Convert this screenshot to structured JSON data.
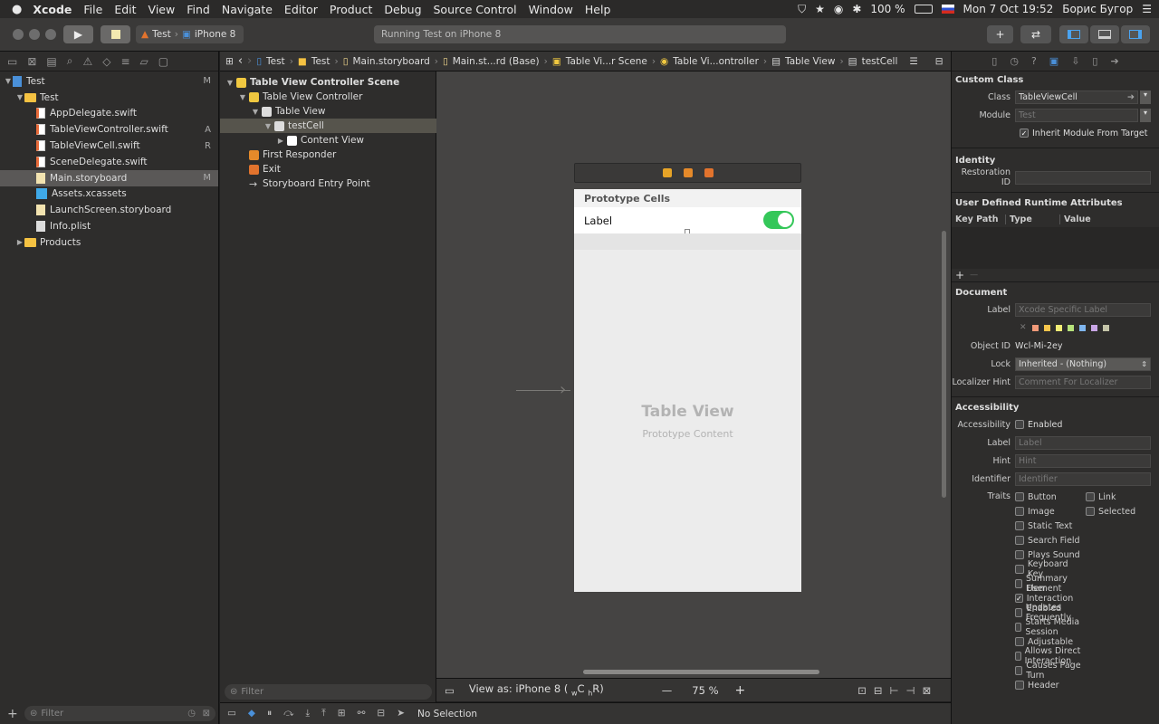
{
  "menubar": {
    "apple": "",
    "app": "Xcode",
    "items": [
      "File",
      "Edit",
      "View",
      "Find",
      "Navigate",
      "Editor",
      "Product",
      "Debug",
      "Source Control",
      "Window",
      "Help"
    ],
    "battery": "100 %",
    "datetime": "Mon 7 Oct  19:52",
    "user": "Борис Бугор"
  },
  "toolbar": {
    "scheme_target": "Test",
    "scheme_device": "iPhone 8",
    "activity": "Running Test on iPhone 8",
    "add": "+",
    "swap": "⇄"
  },
  "navigator": {
    "tree": [
      {
        "label": "Test",
        "badge": "M",
        "indent": 0,
        "type": "project",
        "expanded": true
      },
      {
        "label": "Test",
        "badge": "",
        "indent": 1,
        "type": "folder",
        "expanded": true
      },
      {
        "label": "AppDelegate.swift",
        "badge": "",
        "indent": 2,
        "type": "swift"
      },
      {
        "label": "TableViewController.swift",
        "badge": "A",
        "indent": 2,
        "type": "swift"
      },
      {
        "label": "TableViewCell.swift",
        "badge": "R",
        "indent": 2,
        "type": "swift"
      },
      {
        "label": "SceneDelegate.swift",
        "badge": "",
        "indent": 2,
        "type": "swift"
      },
      {
        "label": "Main.storyboard",
        "badge": "M",
        "indent": 2,
        "type": "storyboard",
        "selected": true
      },
      {
        "label": "Assets.xcassets",
        "badge": "",
        "indent": 2,
        "type": "assets"
      },
      {
        "label": "LaunchScreen.storyboard",
        "badge": "",
        "indent": 2,
        "type": "storyboard"
      },
      {
        "label": "Info.plist",
        "badge": "",
        "indent": 2,
        "type": "plist"
      },
      {
        "label": "Products",
        "badge": "",
        "indent": 1,
        "type": "folder",
        "expanded": false
      }
    ],
    "filter_placeholder": "Filter"
  },
  "jumpbar": {
    "crumbs": [
      "Test",
      "Test",
      "Main.storyboard",
      "Main.st...rd (Base)",
      "Table Vi...r Scene",
      "Table Vi...ontroller",
      "Table View",
      "testCell"
    ]
  },
  "outline": {
    "rows": [
      {
        "label": "Table View Controller Scene",
        "indent": 0,
        "bold": true,
        "tri": "▼"
      },
      {
        "label": "Table View Controller",
        "indent": 1,
        "tri": "▼"
      },
      {
        "label": "Table View",
        "indent": 2,
        "tri": "▼"
      },
      {
        "label": "testCell",
        "indent": 3,
        "tri": "▼",
        "selected": true
      },
      {
        "label": "Content View",
        "indent": 4,
        "tri": "▶"
      },
      {
        "label": "First Responder",
        "indent": 1,
        "tri": ""
      },
      {
        "label": "Exit",
        "indent": 1,
        "tri": ""
      },
      {
        "label": "Storyboard Entry Point",
        "indent": 1,
        "tri": ""
      }
    ],
    "filter_placeholder": "Filter"
  },
  "canvas": {
    "proto_header": "Prototype Cells",
    "cell_label": "Label",
    "tv_title": "Table View",
    "tv_sub": "Prototype Content",
    "view_as_prefix": "View as: iPhone 8 (",
    "view_as_w": "w",
    "view_as_c": "C",
    "view_as_h": "h",
    "view_as_r": "R)",
    "zoom": "75 %",
    "zoom_minus": "—",
    "zoom_plus": "+"
  },
  "debug": {
    "status": "No Selection"
  },
  "inspector": {
    "custom_class": {
      "title": "Custom Class",
      "class_label": "Class",
      "class_value": "TableViewCell",
      "module_label": "Module",
      "module_value": "Test",
      "inherit": "Inherit Module From Target"
    },
    "identity": {
      "title": "Identity",
      "restoration_label": "Restoration ID"
    },
    "udra": {
      "title": "User Defined Runtime Attributes",
      "cols": [
        "Key Path",
        "Type",
        "Value"
      ],
      "add": "+",
      "remove": "—"
    },
    "document": {
      "title": "Document",
      "label_label": "Label",
      "label_placeholder": "Xcode Specific Label",
      "object_id_label": "Object ID",
      "object_id": "Wcl-Mi-2ey",
      "lock_label": "Lock",
      "lock_value": "Inherited - (Nothing)",
      "hint_label": "Localizer Hint",
      "hint_placeholder": "Comment For Localizer",
      "swatch_colors": [
        "#f19a79",
        "#f6c54c",
        "#f2ed75",
        "#b6e27a",
        "#7fb6ef",
        "#c9a6e6",
        "#c4c4a8"
      ]
    },
    "accessibility": {
      "title": "Accessibility",
      "acc_label": "Accessibility",
      "enabled": "Enabled",
      "label_label": "Label",
      "label_placeholder": "Label",
      "hint_label": "Hint",
      "hint_placeholder": "Hint",
      "identifier_label": "Identifier",
      "identifier_placeholder": "Identifier",
      "traits_label": "Traits",
      "traits": [
        {
          "label": "Button",
          "checked": false
        },
        {
          "label": "Image",
          "checked": false
        },
        {
          "label": "Static Text",
          "checked": false
        },
        {
          "label": "Search Field",
          "checked": false
        },
        {
          "label": "Plays Sound",
          "checked": false
        },
        {
          "label": "Keyboard Key",
          "checked": false
        },
        {
          "label": "Summary Element",
          "checked": false
        },
        {
          "label": "User Interaction Enabled",
          "checked": true
        },
        {
          "label": "Updates Frequently",
          "checked": false
        },
        {
          "label": "Starts Media Session",
          "checked": false
        },
        {
          "label": "Adjustable",
          "checked": false
        },
        {
          "label": "Allows Direct Interaction",
          "checked": false
        },
        {
          "label": "Causes Page Turn",
          "checked": false
        },
        {
          "label": "Header",
          "checked": false
        }
      ],
      "traits_right": [
        {
          "label": "Link",
          "checked": false
        },
        {
          "label": "Selected",
          "checked": false
        }
      ]
    }
  }
}
